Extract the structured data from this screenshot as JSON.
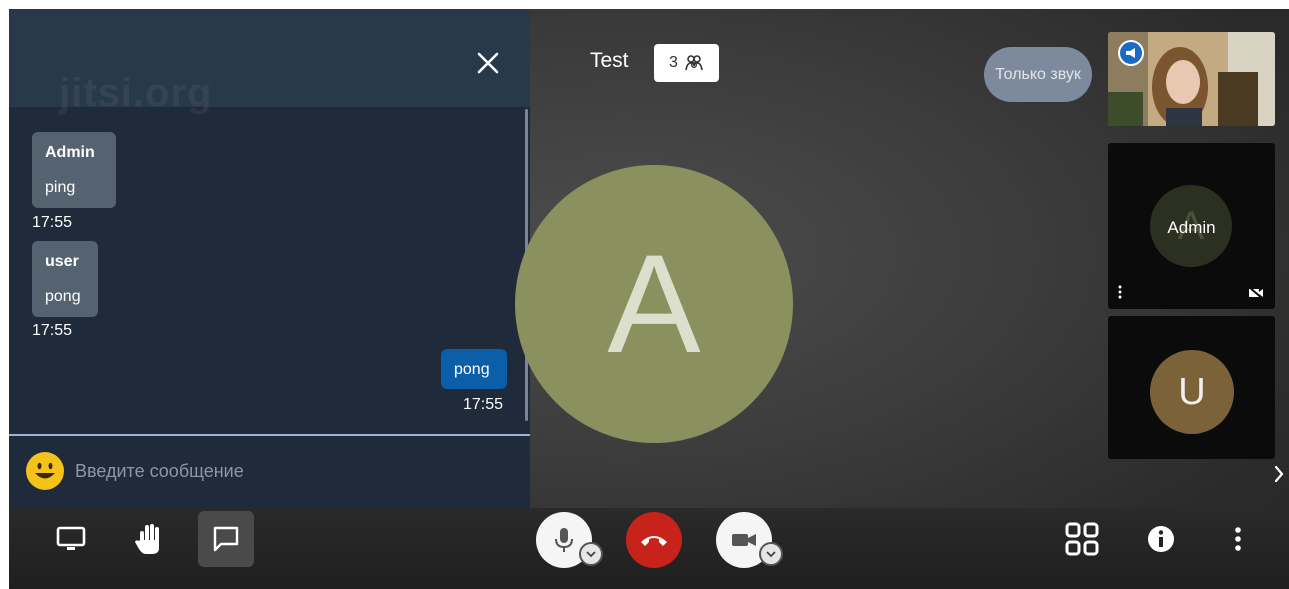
{
  "chat": {
    "watermark": "jitsi.org",
    "messages": [
      {
        "sender": "Admin",
        "text": "ping",
        "time": "17:55"
      },
      {
        "sender": "user",
        "text": "pong",
        "time": "17:55"
      }
    ],
    "own_message": {
      "text": "pong",
      "time": "17:55"
    },
    "input_placeholder": "Введите сообщение"
  },
  "header": {
    "title": "Test",
    "participant_count": "3",
    "audio_only_label": "Только звук"
  },
  "stage": {
    "large_avatar_initial": "A",
    "large_avatar_color": "#8a915e"
  },
  "filmstrip": {
    "admin_name": "Admin",
    "admin_initial": "A",
    "user_initial": "U",
    "user_avatar_color": "#7b6238"
  },
  "toolbar": {
    "left": [
      "screen-share-icon",
      "raise-hand-icon",
      "chat-icon"
    ],
    "center": [
      "microphone-icon",
      "hangup-icon",
      "camera-icon"
    ],
    "right": [
      "tile-view-icon",
      "info-icon",
      "more-options-icon"
    ]
  }
}
